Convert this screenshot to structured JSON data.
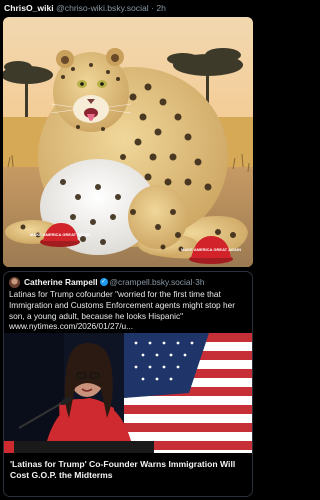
{
  "post": {
    "author": "ChrisO_wiki",
    "handle": "@chriso-wiki.bsky.social",
    "separator": "·",
    "age": "2h"
  },
  "image": {
    "sign_left": "MAKE AMERICA GREAT AGAIN",
    "sign_right": "MAKE AMERICA GREAT AGAIN"
  },
  "quote": {
    "author": "Catherine Rampell",
    "verified_glyph": "✓",
    "handle": "@crampell.bsky.social",
    "separator": "·",
    "age": "3h",
    "text": "Latinas for Trump cofounder \"worried for the first time that Immigration and Customs Enforcement agents might stop her son, a young adult, because he looks Hispanic\"",
    "link": "www.nytimes.com/2026/01/27/u...",
    "link_title": "'Latinas for Trump' Co-Founder Warns Immigration Will Cost G.O.P. the Midterms"
  },
  "colors": {
    "background": "#000000",
    "muted_text": "#8b98a5",
    "verified": "#1d9bf0",
    "card_border": "#2a3139"
  }
}
